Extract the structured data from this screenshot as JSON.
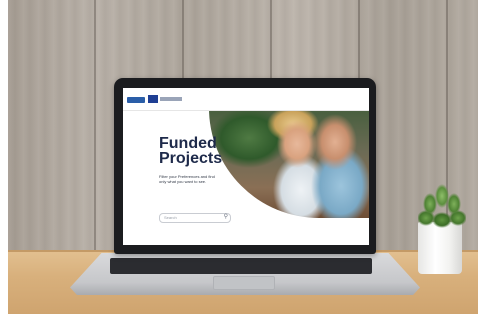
{
  "screen_site": {
    "title_line1": "Funded",
    "title_line2": "Projects",
    "subtitle": "Filter your Preferences and find only what you want to see.",
    "search": {
      "placeholder": "Search",
      "icon": "search-icon"
    }
  },
  "scene": {
    "objects": [
      "wooden-wall",
      "wooden-desk",
      "laptop",
      "potted-succulent"
    ],
    "colors": {
      "title": "#1e2a4a",
      "laptop_bezel": "#1b1c1f",
      "desk": "#d8b07c"
    }
  }
}
